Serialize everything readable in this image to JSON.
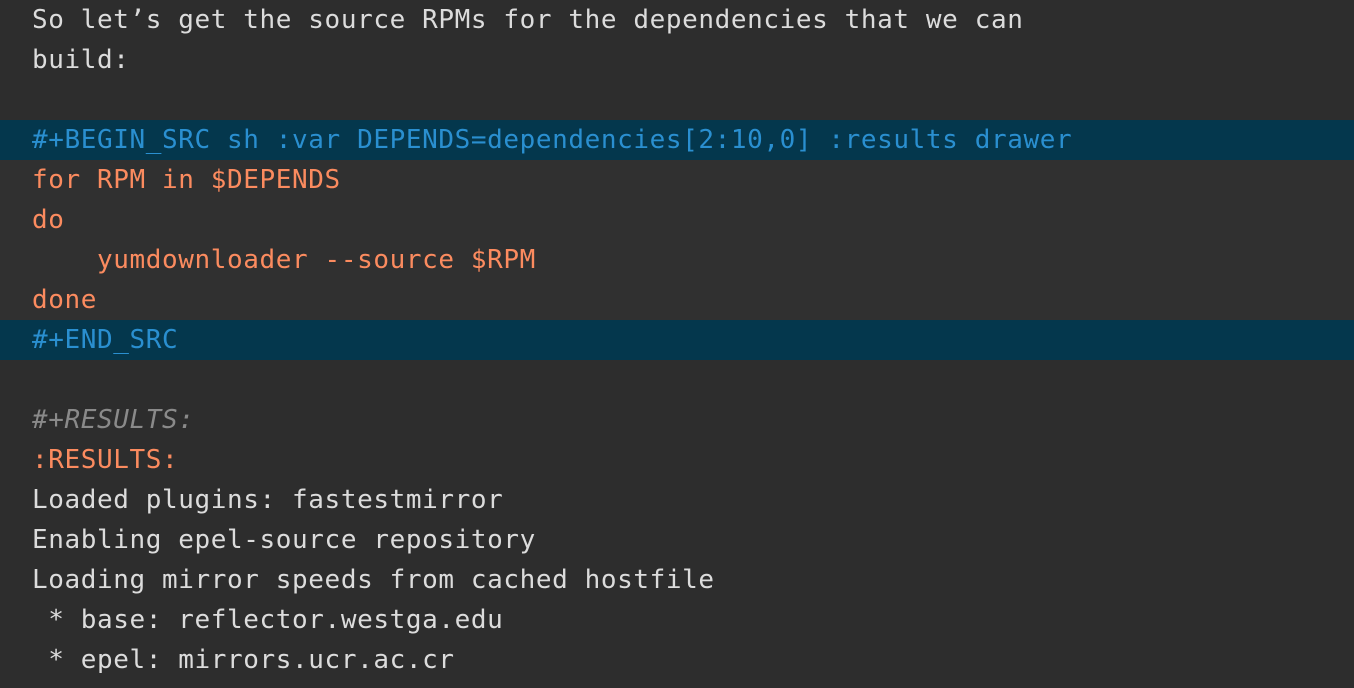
{
  "editor": {
    "theme": {
      "page_background": "#2d2d2d",
      "src_block_background": "#303030",
      "src_delimiter_background": "#04374d",
      "delimiter_text": "#2a8fd0",
      "code_text": "#fb8b5f",
      "prose_text": "#dcdcdc",
      "keyword_text": "#8a8a8a"
    }
  },
  "prose": {
    "line1": "So let’s get the source RPMs for the dependencies that we can",
    "line2": "build:"
  },
  "source_block": {
    "begin_line": "#+BEGIN_SRC sh :var DEPENDS=dependencies[2:10,0] :results drawer",
    "end_line": "#+END_SRC",
    "language": "sh",
    "header_args": {
      "var": "DEPENDS=dependencies[2:10,0]",
      "results": "drawer"
    },
    "code": [
      "for RPM in $DEPENDS",
      "do",
      "    yumdownloader --source $RPM",
      "done"
    ]
  },
  "results": {
    "keyword": "#+RESULTS:",
    "drawer_open": ":RESULTS:",
    "output": [
      "Loaded plugins: fastestmirror",
      "Enabling epel-source repository",
      "Loading mirror speeds from cached hostfile",
      " * base: reflector.westga.edu",
      " * epel: mirrors.ucr.ac.cr"
    ]
  }
}
